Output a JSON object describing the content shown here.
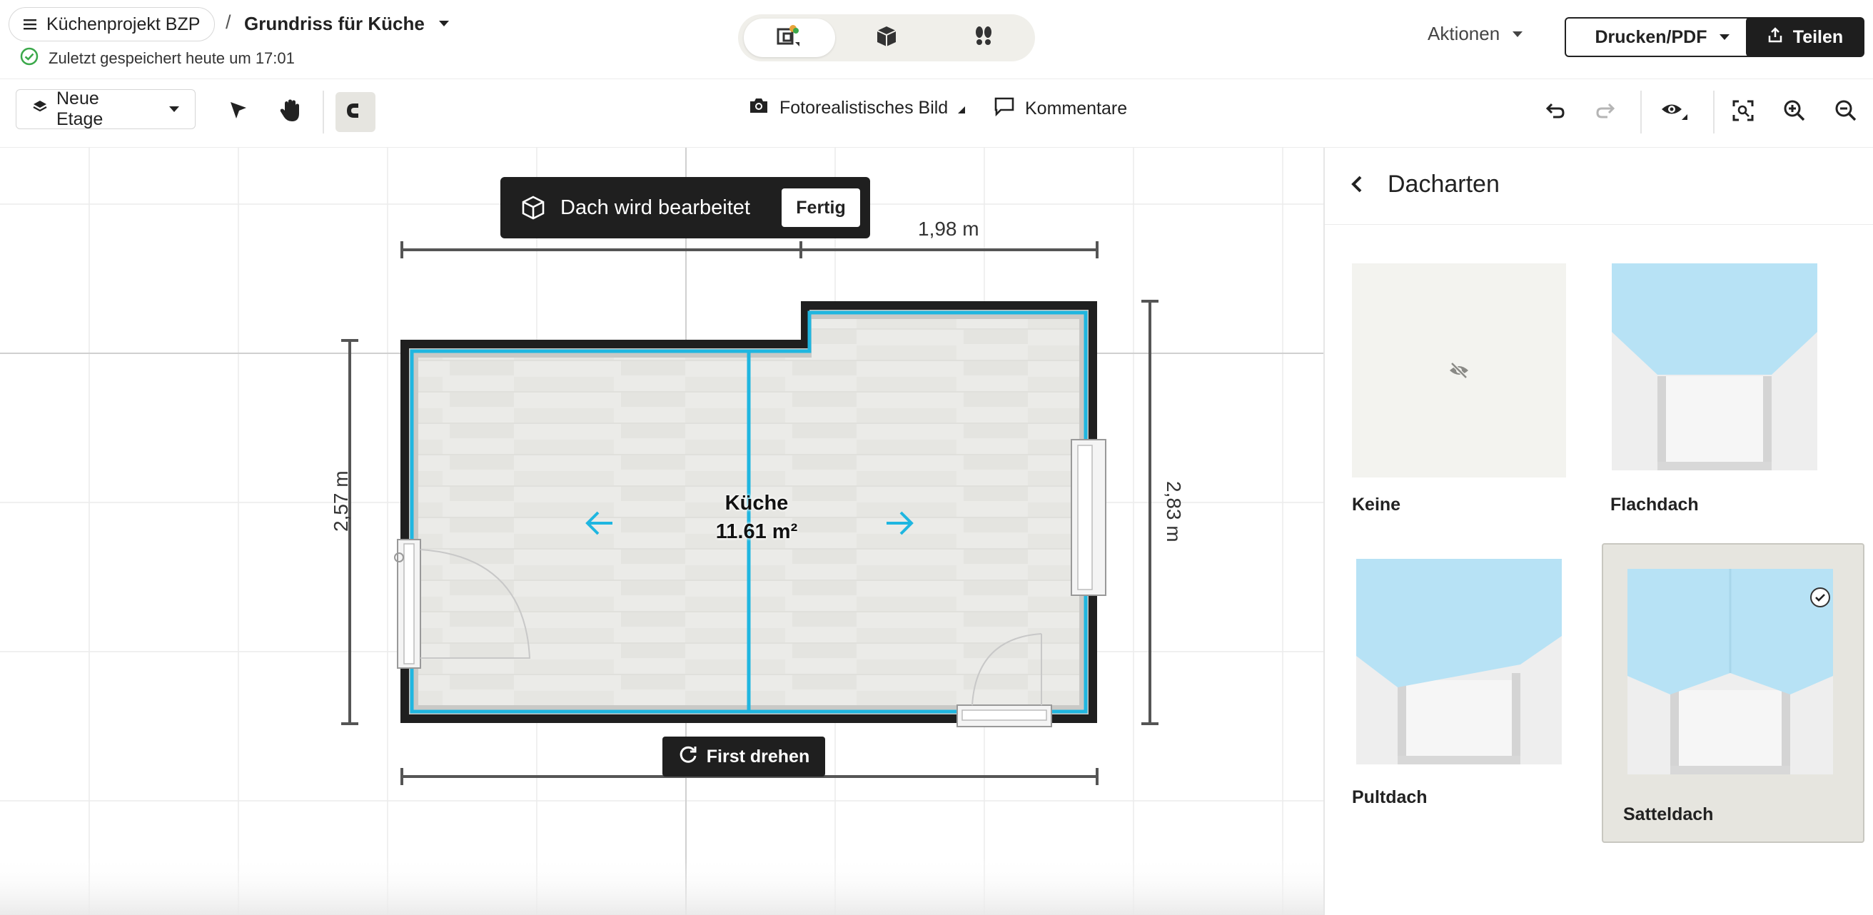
{
  "header": {
    "project_name": "Küchenprojekt BZP",
    "breadcrumb_separator": "/",
    "plan_name": "Grundriss für Küche",
    "saved_status": "Zuletzt gespeichert heute um 17:01",
    "actions_label": "Aktionen",
    "print_label": "Drucken/PDF",
    "share_label": "Teilen"
  },
  "toolbar": {
    "floor_label": "Neue Etage",
    "photo_label": "Fotorealistisches Bild",
    "comments_label": "Kommentare"
  },
  "canvas": {
    "toast_text": "Dach wird bearbeitet",
    "toast_button": "Fertig",
    "rotate_label": "First drehen",
    "room_name": "Küche",
    "room_area": "11.61 m²",
    "dim_top_right": "1,98 m",
    "dim_left": "2,57 m",
    "dim_right": "2,83 m"
  },
  "panel": {
    "title": "Dacharten",
    "roof_types": [
      {
        "label": "Keine",
        "selected": false
      },
      {
        "label": "Flachdach",
        "selected": false
      },
      {
        "label": "Pultdach",
        "selected": false
      },
      {
        "label": "Satteldach",
        "selected": true
      }
    ]
  },
  "colors": {
    "accent": "#1fb6e0",
    "wall": "#1f1f1f",
    "sky": "#b7e2f5",
    "selected_card": "#e6e5df",
    "success": "#3aa84a"
  }
}
